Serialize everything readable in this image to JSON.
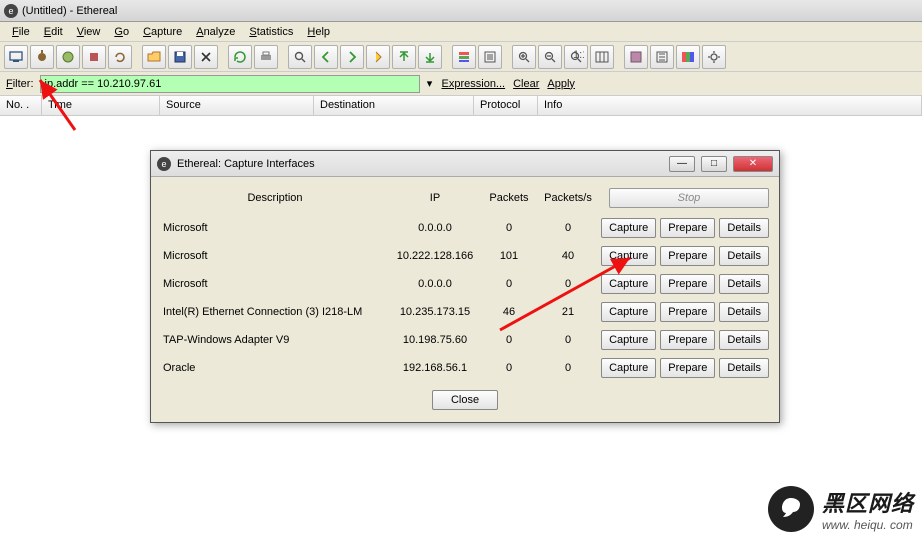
{
  "window_title": "(Untitled) - Ethereal",
  "menus": [
    "File",
    "Edit",
    "View",
    "Go",
    "Capture",
    "Analyze",
    "Statistics",
    "Help"
  ],
  "filter": {
    "label": "Filter:",
    "value": "ip.addr == 10.210.97.61",
    "expression": "Expression...",
    "clear": "Clear",
    "apply": "Apply"
  },
  "columns": {
    "no": "No. .",
    "time": "Time",
    "src": "Source",
    "dst": "Destination",
    "proto": "Protocol",
    "info": "Info"
  },
  "dialog": {
    "title": "Ethereal: Capture Interfaces",
    "headers": {
      "desc": "Description",
      "ip": "IP",
      "packets": "Packets",
      "pps": "Packets/s"
    },
    "stop": "Stop",
    "btn_capture": "Capture",
    "btn_prepare": "Prepare",
    "btn_details": "Details",
    "close": "Close",
    "rows": [
      {
        "desc": "Microsoft",
        "ip": "0.0.0.0",
        "packets": "0",
        "pps": "0"
      },
      {
        "desc": "Microsoft",
        "ip": "10.222.128.166",
        "packets": "101",
        "pps": "40"
      },
      {
        "desc": "Microsoft",
        "ip": "0.0.0.0",
        "packets": "0",
        "pps": "0"
      },
      {
        "desc": "Intel(R) Ethernet Connection (3) I218-LM",
        "ip": "10.235.173.15",
        "packets": "46",
        "pps": "21"
      },
      {
        "desc": "TAP-Windows Adapter V9",
        "ip": "10.198.75.60",
        "packets": "0",
        "pps": "0"
      },
      {
        "desc": "Oracle",
        "ip": "192.168.56.1",
        "packets": "0",
        "pps": "0"
      }
    ]
  },
  "watermark": {
    "cn": "黑区网络",
    "en": "www. heiqu. com"
  }
}
